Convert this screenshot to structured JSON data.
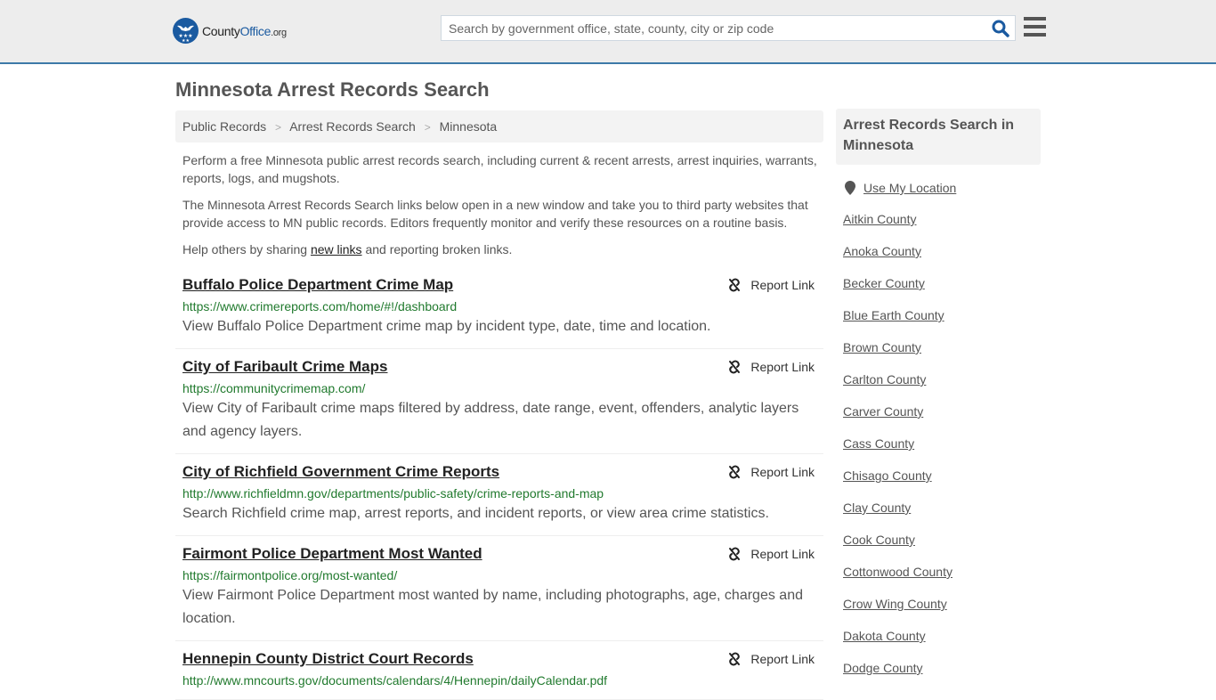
{
  "header": {
    "logo": {
      "prefix": "County",
      "brand": "Office",
      "tld": ".org"
    },
    "search_placeholder": "Search by government office, state, county, city or zip code",
    "search_icon": "magnifier-icon",
    "menu_icon": "hamburger-icon",
    "accent_color": "#3d79a8"
  },
  "page": {
    "title": "Minnesota Arrest Records Search",
    "breadcrumb": [
      "Public Records",
      "Arrest Records Search",
      "Minnesota"
    ],
    "breadcrumb_separator": ">",
    "intro": [
      "Perform a free Minnesota public arrest records search, including current & recent arrests, arrest inquiries, warrants, reports, logs, and mugshots.",
      "The Minnesota Arrest Records Search links below open in a new window and take you to third party websites that provide access to MN public records. Editors frequently monitor and verify these resources on a routine basis."
    ],
    "share": {
      "before": "Help others by sharing ",
      "link": "new links",
      "after": " and reporting broken links."
    }
  },
  "results": [
    {
      "title": "Buffalo Police Department Crime Map",
      "url": "https://www.crimereports.com/home/#!/dashboard",
      "description": "View Buffalo Police Department crime map by incident type, date, time and location.",
      "report_label": "Report Link"
    },
    {
      "title": "City of Faribault Crime Maps",
      "url": "https://communitycrimemap.com/",
      "description": "View City of Faribault crime maps filtered by address, date range, event, offenders, analytic layers and agency layers.",
      "report_label": "Report Link"
    },
    {
      "title": "City of Richfield Government Crime Reports",
      "url": "http://www.richfieldmn.gov/departments/public-safety/crime-reports-and-map",
      "description": "Search Richfield crime map, arrest reports, and incident reports, or view area crime statistics.",
      "report_label": "Report Link"
    },
    {
      "title": "Fairmont Police Department Most Wanted",
      "url": "https://fairmontpolice.org/most-wanted/",
      "description": "View Fairmont Police Department most wanted by name, including photographs, age, charges and location.",
      "report_label": "Report Link"
    },
    {
      "title": "Hennepin County District Court Records",
      "url": "http://www.mncourts.gov/documents/calendars/4/Hennepin/dailyCalendar.pdf",
      "description": "",
      "report_label": "Report Link"
    }
  ],
  "sidebar": {
    "heading": "Arrest Records Search in Minnesota",
    "location_label": "Use My Location",
    "counties": [
      "Aitkin County",
      "Anoka County",
      "Becker County",
      "Blue Earth County",
      "Brown County",
      "Carlton County",
      "Carver County",
      "Cass County",
      "Chisago County",
      "Clay County",
      "Cook County",
      "Cottonwood County",
      "Crow Wing County",
      "Dakota County",
      "Dodge County"
    ]
  }
}
